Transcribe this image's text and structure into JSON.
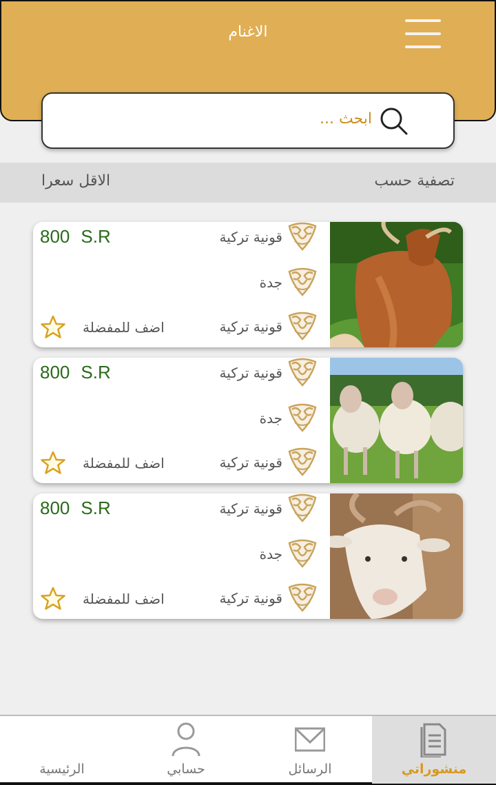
{
  "header": {
    "title": "الاغنام"
  },
  "search": {
    "placeholder": "ابحث ..."
  },
  "filter": {
    "label": "تصفية حسب",
    "value": "الاقل سعرا"
  },
  "listings": [
    {
      "price": "800",
      "currency": "S.R",
      "breed": "قونية تركية",
      "city": "جدة",
      "type": "قونية تركية",
      "fav_label": "اضف للمفضلة",
      "image": "goat-brown"
    },
    {
      "price": "800",
      "currency": "S.R",
      "breed": "قونية تركية",
      "city": "جدة",
      "type": "قونية تركية",
      "fav_label": "اضف للمفضلة",
      "image": "sheep-flock"
    },
    {
      "price": "800",
      "currency": "S.R",
      "breed": "قونية تركية",
      "city": "جدة",
      "type": "قونية تركية",
      "fav_label": "اضف للمفضلة",
      "image": "goat-white"
    }
  ],
  "nav": {
    "home": "الرئيسية",
    "account": "حسابي",
    "messages": "الرسائل",
    "my_posts": "منشوراتي"
  },
  "colors": {
    "brand": "#e0ae54",
    "price": "#2a6a1a",
    "active_nav": "#d79a1f"
  }
}
